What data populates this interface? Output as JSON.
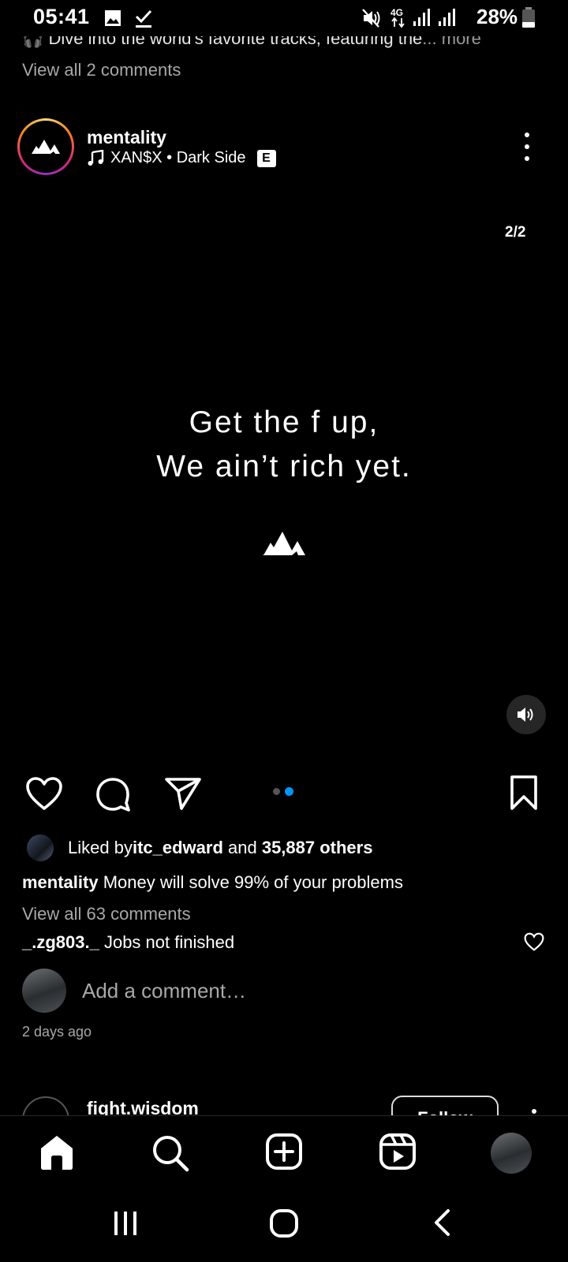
{
  "status_bar": {
    "time": "05:41",
    "battery": "28%",
    "icons": [
      "gallery-icon",
      "download-done-icon",
      "mute-icon",
      "4g-icon",
      "signal-icon",
      "signal-icon",
      "battery-icon"
    ]
  },
  "previous_post": {
    "caption": "Dive into the world's favorite tracks, featuring the",
    "more": "... more",
    "view_all": "View all 2 comments"
  },
  "post": {
    "username": "mentality",
    "music": "XAN$X • Dark Side",
    "explicit": "E",
    "counter": "2/2",
    "quote_line1": "Get the f up,",
    "quote_line2": "We ain’t rich yet.",
    "carousel": {
      "count": 2,
      "active": 2
    },
    "liked_prefix": "Liked by ",
    "liked_user": "itc_edward",
    "liked_and": " and ",
    "liked_count": "35,887 others",
    "caption_user": "mentality",
    "caption_text": " Money will solve 99% of your problems",
    "view_comments": "View all 63 comments",
    "comment_user": "_.zg803._",
    "comment_text": " Jobs not finished",
    "add_comment_placeholder": "Add a comment…",
    "time_ago": "2 days ago"
  },
  "next_post": {
    "username": "fight.wisdom",
    "follow_label": "Follow"
  },
  "colors": {
    "background": "#000000",
    "accent_blue": "#0095f6",
    "secondary_text": "#a8a8a8"
  },
  "bottom_nav": [
    "home-icon",
    "search-icon",
    "create-icon",
    "reels-icon",
    "profile-avatar"
  ],
  "system_nav": [
    "recents-button",
    "home-button",
    "back-button"
  ]
}
